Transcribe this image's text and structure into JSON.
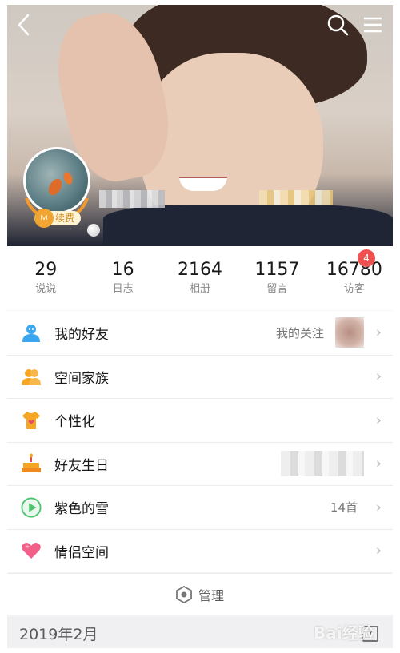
{
  "header": {
    "back_icon": "chevron-left-icon",
    "search_icon": "search-icon",
    "menu_icon": "hamburger-menu-icon"
  },
  "profile": {
    "vip_badge": "续费",
    "vip_level_label": "lvl"
  },
  "stats": [
    {
      "value": "29",
      "label": "说说"
    },
    {
      "value": "16",
      "label": "日志"
    },
    {
      "value": "2164",
      "label": "相册"
    },
    {
      "value": "1157",
      "label": "留言"
    },
    {
      "value": "16780",
      "label": "访客"
    }
  ],
  "visitor_badge": "4",
  "menu": {
    "friends": {
      "label": "我的好友",
      "extra": "我的关注",
      "icon": "person-icon",
      "color": "#3aa7f0"
    },
    "family": {
      "label": "空间家族",
      "icon": "group-icon",
      "color": "#f5a623"
    },
    "personalize": {
      "label": "个性化",
      "icon": "tshirt-heart-icon",
      "color": "#f5a623"
    },
    "birthday": {
      "label": "好友生日",
      "icon": "cake-icon",
      "color": "#f5a623"
    },
    "music": {
      "label": "紫色的雪",
      "extra": "14首",
      "icon": "play-circle-icon",
      "color": "#4cc46f"
    },
    "couple": {
      "label": "情侣空间",
      "icon": "heart-icon",
      "color": "#f2608a"
    }
  },
  "manage": {
    "label": "管理",
    "icon": "hexagon-settings-icon"
  },
  "timeline": {
    "date": "2019年2月",
    "calendar_icon": "calendar-icon",
    "calendar_day": "7"
  },
  "watermark": "Bai经验"
}
